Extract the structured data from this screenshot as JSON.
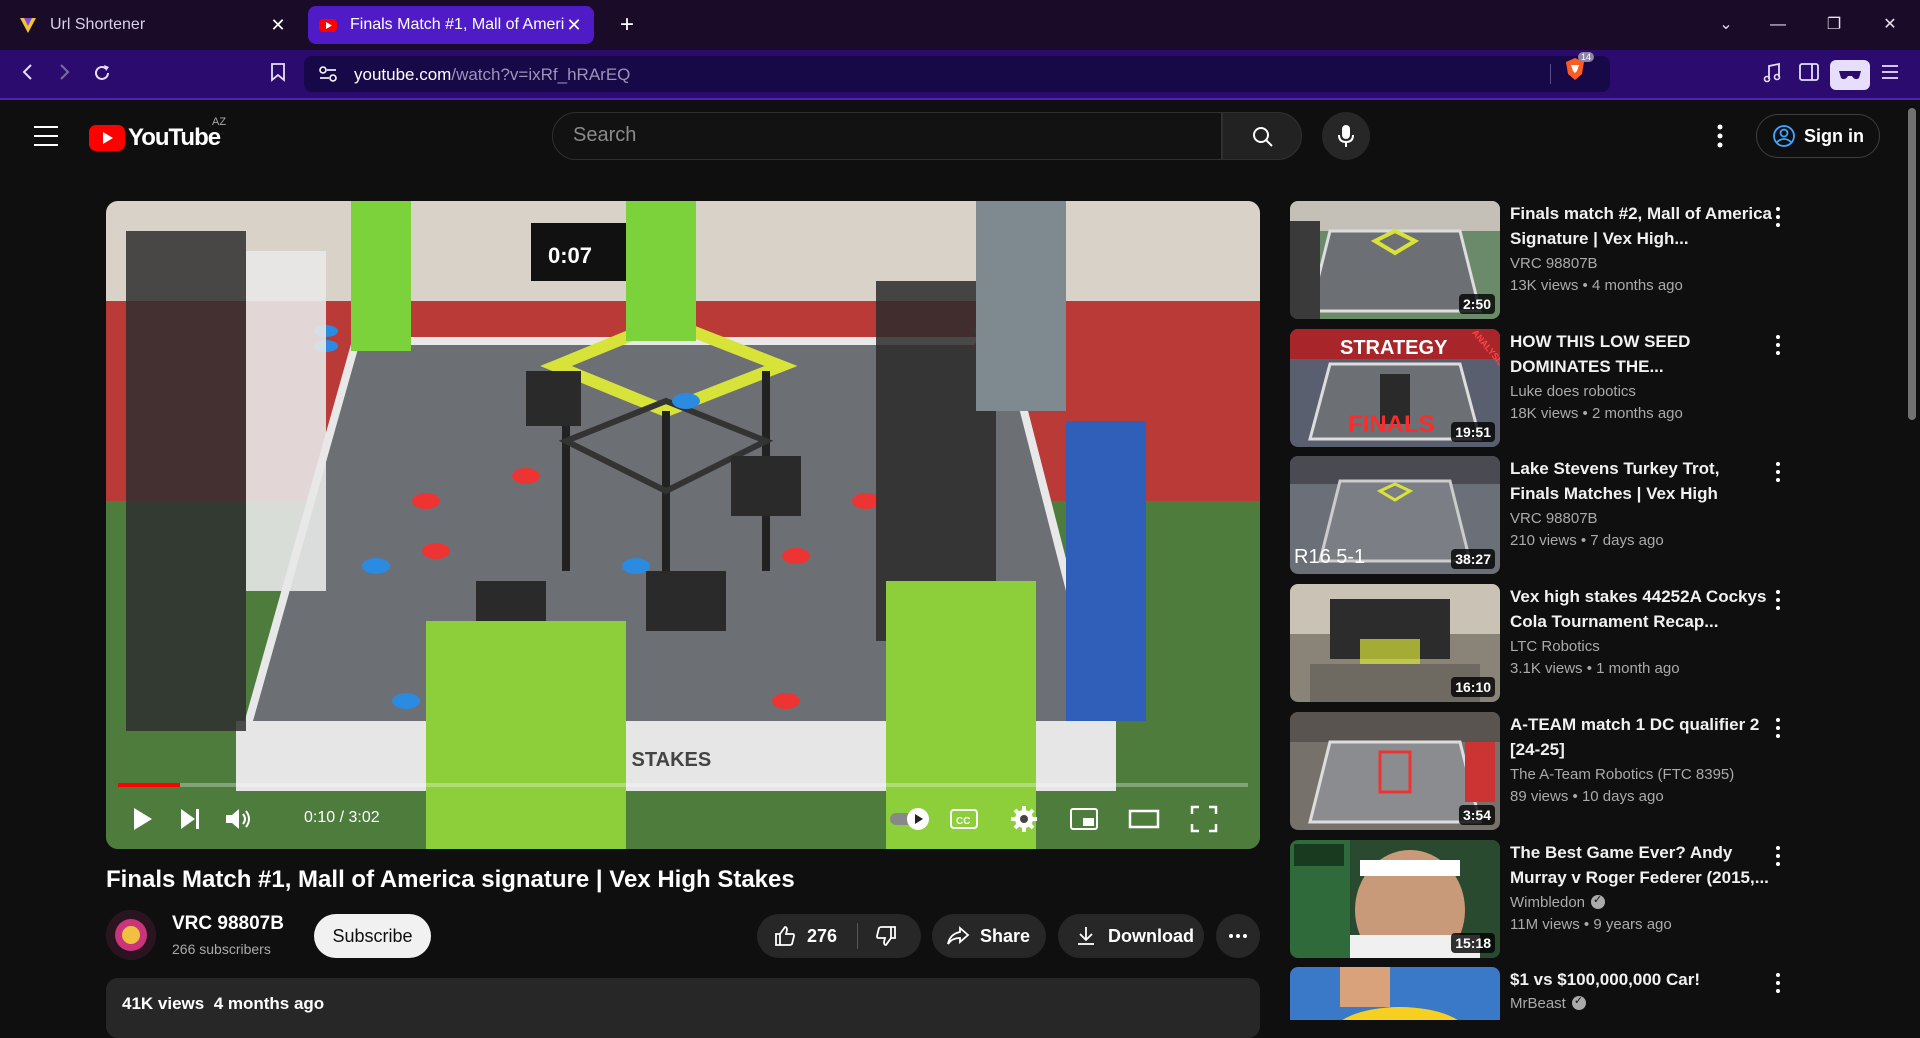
{
  "browser": {
    "tabs": [
      {
        "title": "Url Shortener",
        "active": false
      },
      {
        "title": "Finals Match #1, Mall of America signature | Vex High Stakes",
        "active": true
      }
    ],
    "url_host": "youtube.com",
    "url_path": "/watch?v=ixRf_hRArEQ",
    "shield_count": "14",
    "accent": "#4e1bc7"
  },
  "header": {
    "logo_text": "YouTube",
    "country_code": "AZ",
    "search_placeholder": "Search",
    "signin_label": "Sign in"
  },
  "player": {
    "scoreboard_time": "0:07",
    "time_display": "0:10 / 3:02",
    "progress_fraction": 0.055,
    "field_banner": "HIGH STAKES"
  },
  "video": {
    "title": "Finals Match #1, Mall of America signature | Vex High Stakes",
    "channel_name": "VRC 98807B",
    "subscribers": "266 subscribers",
    "subscribe_label": "Subscribe",
    "likes": "276",
    "share_label": "Share",
    "download_label": "Download",
    "views": "41K views",
    "age": "4 months ago"
  },
  "recommendations": [
    {
      "title": "Finals match #2, Mall of America Signature | Vex High...",
      "channel": "VRC 98807B",
      "verified": false,
      "views": "13K views",
      "age": "4 months ago",
      "duration": "2:50",
      "thumb_color": "#6a8a6a"
    },
    {
      "title": "HOW THIS LOW SEED DOMINATES THE...",
      "channel": "Luke does robotics",
      "verified": false,
      "views": "18K views",
      "age": "2 months ago",
      "duration": "19:51",
      "thumb_color": "#5a5f70",
      "overlay_top": "STRATEGY",
      "overlay_bottom": "FINALS",
      "overlay_corner": "ANALYSIS"
    },
    {
      "title": "Lake Stevens Turkey Trot, Finals Matches | Vex High Stakes",
      "channel": "VRC 98807B",
      "verified": false,
      "views": "210 views",
      "age": "7 days ago",
      "duration": "38:27",
      "thumb_color": "#6b6f78",
      "overlay_bottom": "R16 5-1"
    },
    {
      "title": "Vex high stakes 44252A Cockys Cola Tournament Recap...",
      "channel": "LTC Robotics",
      "verified": false,
      "views": "3.1K views",
      "age": "1 month ago",
      "duration": "16:10",
      "thumb_color": "#8a8478"
    },
    {
      "title": "A-TEAM match 1 DC qualifier 2 [24-25]",
      "channel": "The A-Team Robotics (FTC 8395)",
      "verified": false,
      "views": "89 views",
      "age": "10 days ago",
      "duration": "3:54",
      "thumb_color": "#77716c"
    },
    {
      "title": "The Best Game Ever? Andy Murray v Roger Federer (2015,...",
      "channel": "Wimbledon",
      "verified": true,
      "views": "11M views",
      "age": "9 years ago",
      "duration": "15:18",
      "thumb_color": "#2e6a3a"
    },
    {
      "title": "$1 vs $100,000,000 Car!",
      "channel": "MrBeast",
      "verified": true,
      "views": "",
      "age": "",
      "duration": "",
      "thumb_color": "#3a78c8"
    }
  ]
}
